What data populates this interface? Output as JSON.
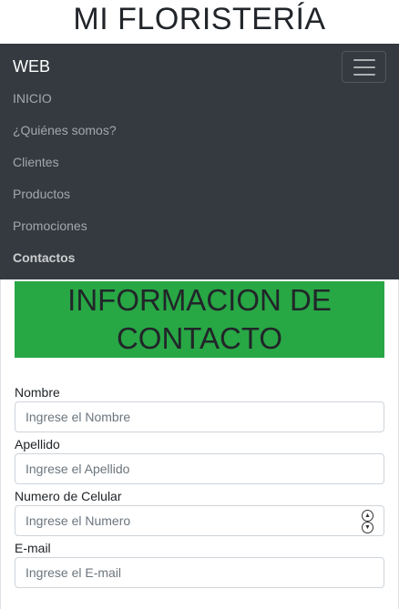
{
  "header": {
    "title": "MI FLORISTERÍA"
  },
  "navbar": {
    "brand": "WEB",
    "items": [
      {
        "label": "INICIO"
      },
      {
        "label": "¿Quiénes somos?"
      },
      {
        "label": "Clientes"
      },
      {
        "label": "Productos"
      },
      {
        "label": "Promociones"
      },
      {
        "label": "Contactos"
      }
    ],
    "active_item": "Contactos"
  },
  "banner": {
    "line1": "INFORMACION DE",
    "line2": "CONTACTO"
  },
  "form": {
    "nombre": {
      "label": "Nombre",
      "placeholder": "Ingrese el Nombre"
    },
    "apellido": {
      "label": "Apellido",
      "placeholder": "Ingrese el Apellido"
    },
    "celular": {
      "label": "Numero de Celular",
      "placeholder": "Ingrese el Numero"
    },
    "email": {
      "label": "E-mail",
      "placeholder": "Ingrese el E-mail"
    }
  },
  "colors": {
    "navbar_bg": "#343a40",
    "banner_bg": "#28a745"
  }
}
